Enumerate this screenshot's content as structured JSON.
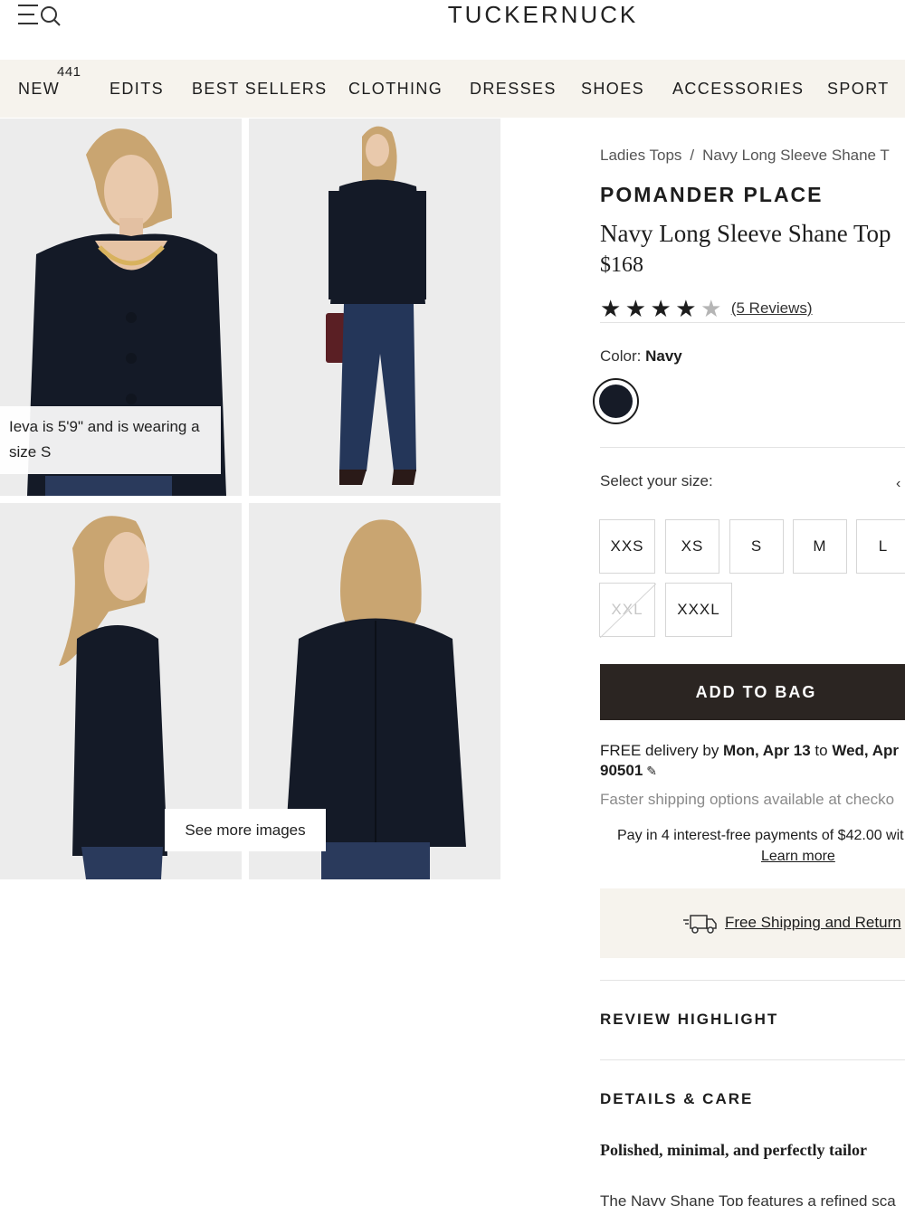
{
  "header": {
    "logo": "TUCKERNUCK",
    "menu_icon": "menu-search-icon"
  },
  "nav": {
    "items": [
      "NEW",
      "EDITS",
      "BEST SELLERS",
      "CLOTHING",
      "DRESSES",
      "SHOES",
      "ACCESSORIES",
      "SPORT"
    ],
    "new_badge": "441"
  },
  "gallery": {
    "caption": "Ieva is 5'9\" and is wearing a size S",
    "see_more": "See more images"
  },
  "product": {
    "breadcrumb": [
      "Ladies Tops",
      "Navy Long Sleeve Shane T"
    ],
    "breadcrumb_sep": "/",
    "brand": "POMANDER PLACE",
    "title": "Navy Long Sleeve Shane Top",
    "price": "$168",
    "rating": 4,
    "rating_max": 5,
    "reviews_link": "(5 Reviews)",
    "color_label": "Color:",
    "color_value": "Navy",
    "swatch_color": "#161b27",
    "size_label": "Select your size:",
    "sizes": [
      {
        "label": "XXS",
        "available": true
      },
      {
        "label": "XS",
        "available": true
      },
      {
        "label": "S",
        "available": true
      },
      {
        "label": "M",
        "available": true
      },
      {
        "label": "L",
        "available": true
      },
      {
        "label": "XXL",
        "available": false
      },
      {
        "label": "XXXL",
        "available": true
      }
    ],
    "add_to_bag": "ADD TO BAG",
    "delivery_prefix": "FREE delivery by ",
    "delivery_from": "Mon, Apr 13",
    "delivery_mid": " to ",
    "delivery_to": "Wed, Apr",
    "zip": "90501",
    "faster_shipping": "Faster shipping options available at checko",
    "pay_in_4": "Pay in 4 interest-free payments of $42.00 wit",
    "learn_more": "Learn more",
    "free_shipping": "Free Shipping and Return",
    "review_highlight": "REVIEW HIGHLIGHT",
    "details_care": "DETAILS & CARE",
    "details_bold": "Polished, minimal, and perfectly tailor",
    "details_text": "The Navy Shane Top features a refined sca"
  },
  "colors": {
    "nav_bg": "#f6f3ed",
    "button_dark": "#2b2522",
    "navy": "#161b27"
  }
}
